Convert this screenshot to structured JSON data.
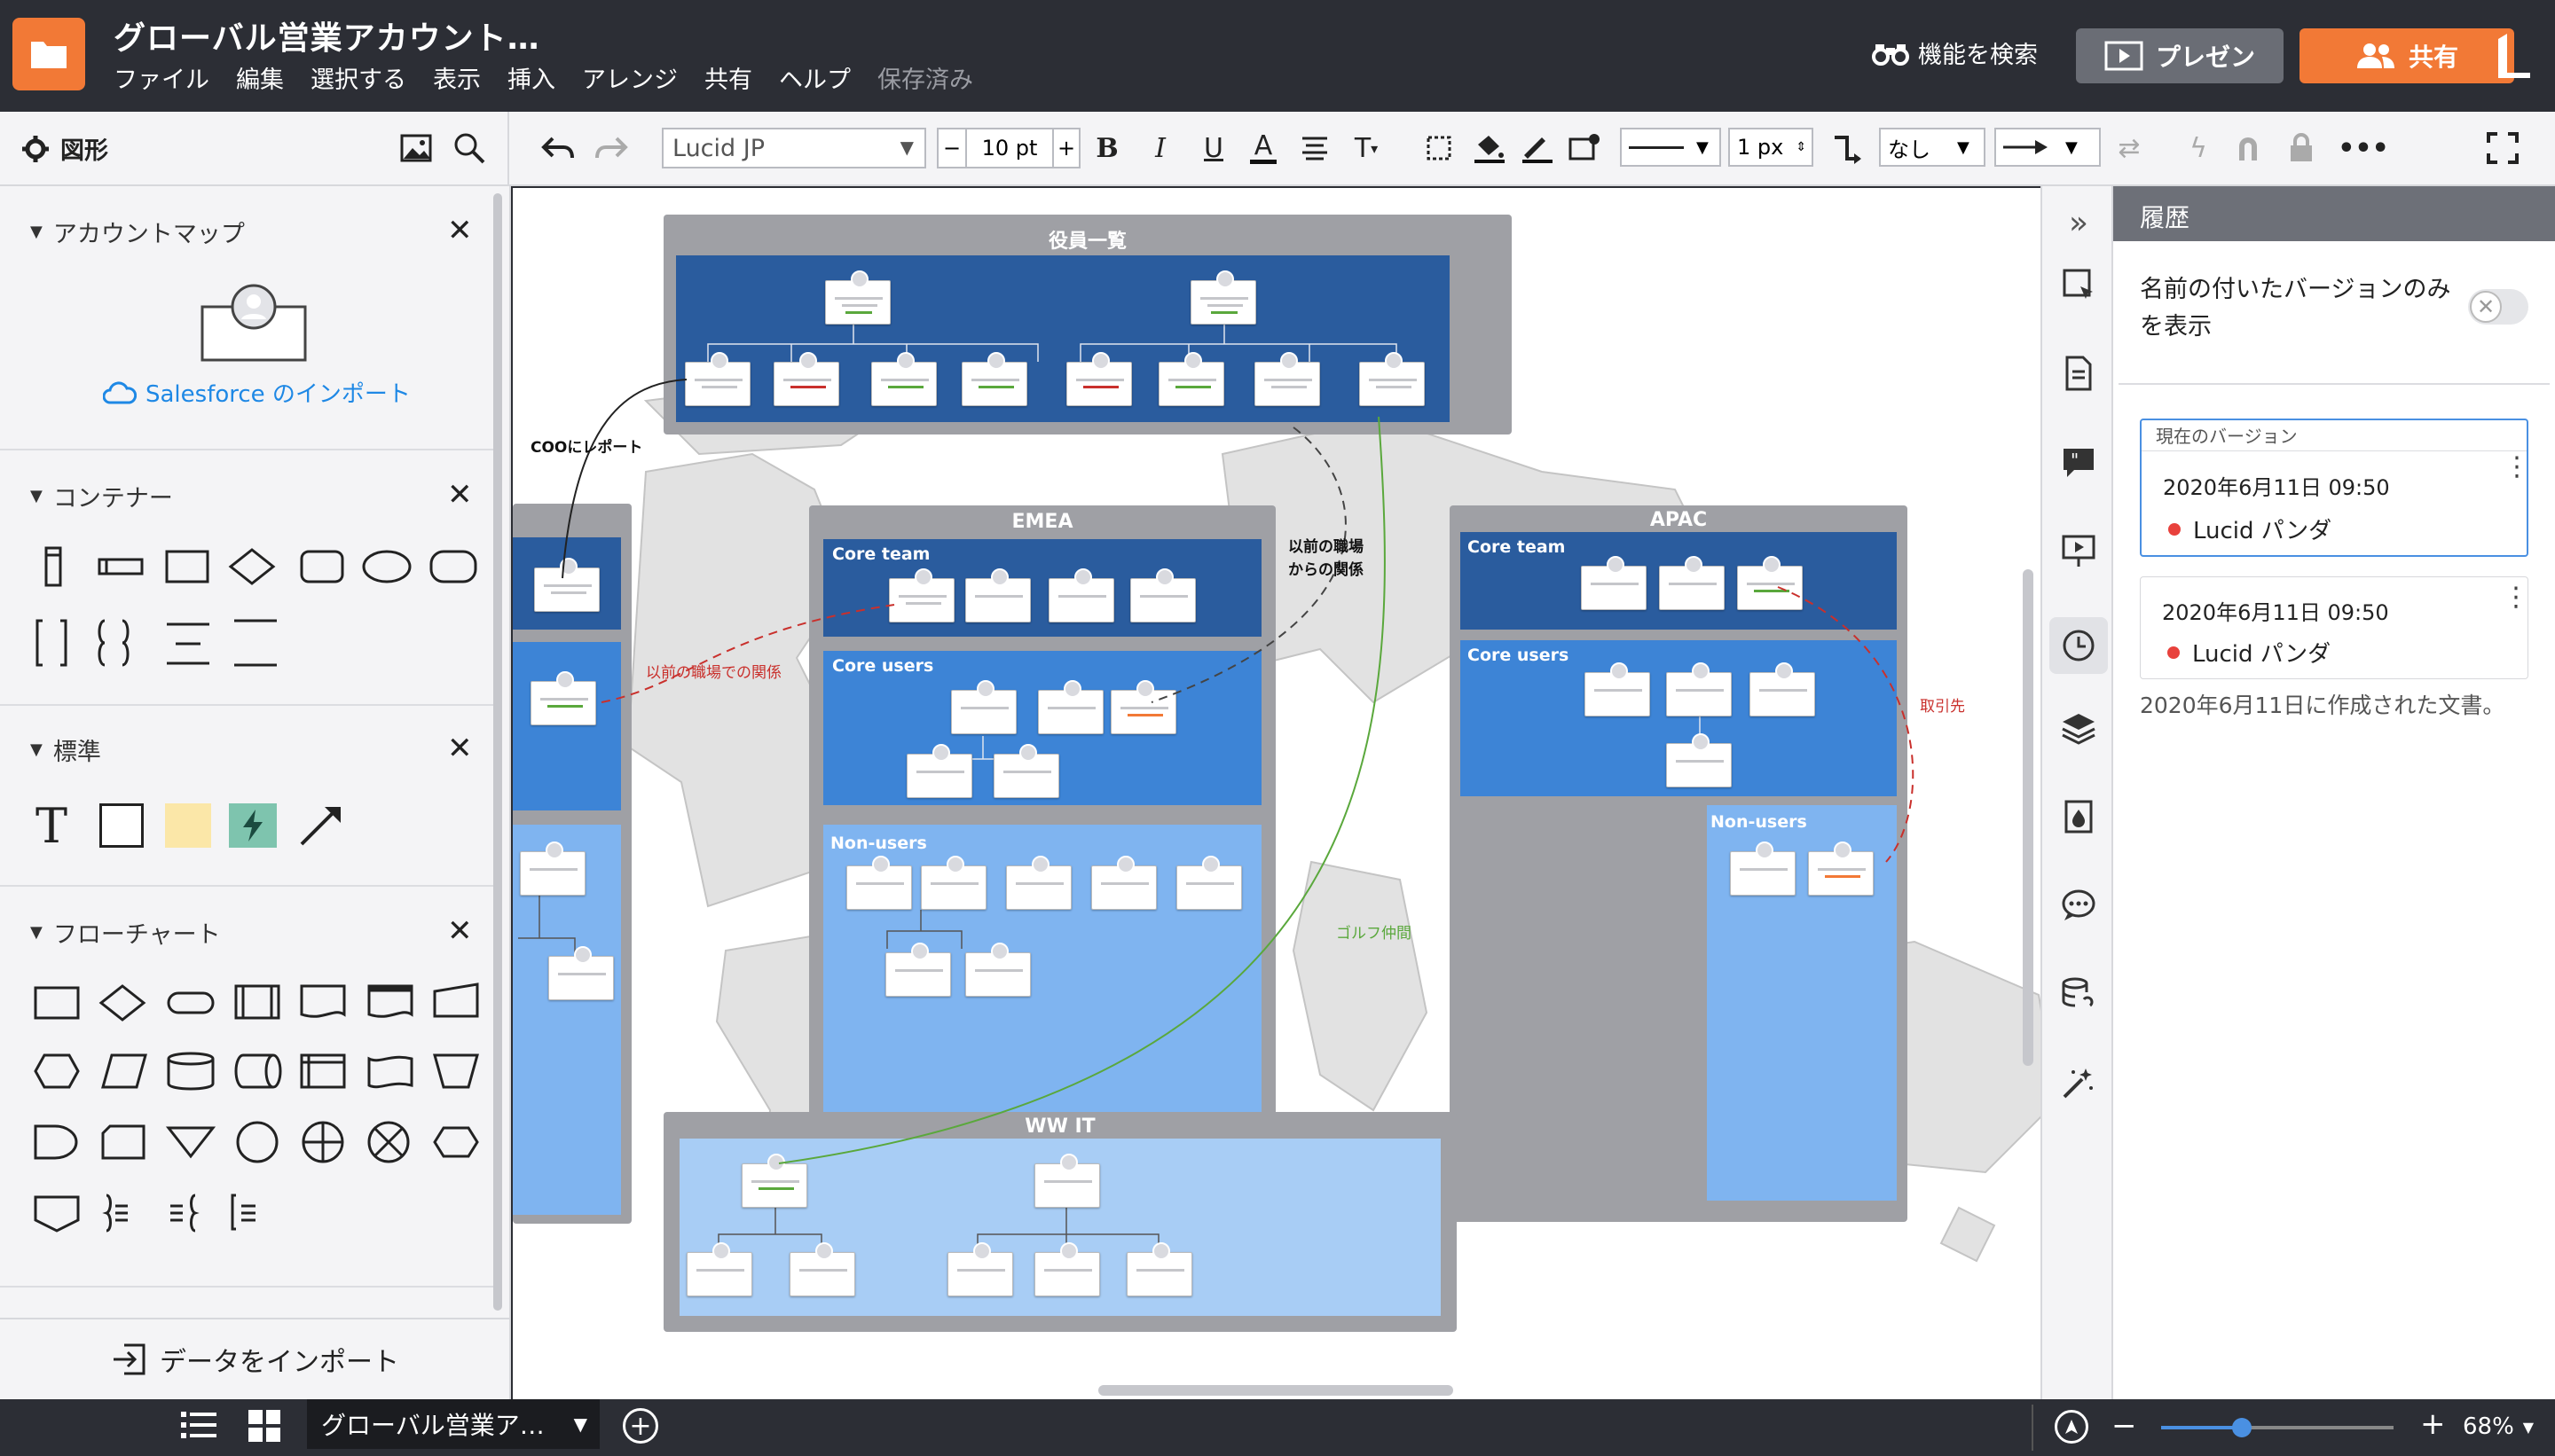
{
  "app": {
    "document_title": "グローバル営業アカウント…",
    "menu": [
      "ファイル",
      "編集",
      "選択する",
      "表示",
      "挿入",
      "アレンジ",
      "共有",
      "ヘルプ"
    ],
    "saved_status": "保存済み",
    "find_feature": "機能を検索",
    "present_label": "プレゼン",
    "share_label": "共有"
  },
  "toolbar": {
    "shapes_label": "図形",
    "font": "Lucid JP",
    "font_size": "10 pt",
    "line_width": "1 px",
    "arrow_none": "なし"
  },
  "left_panel": {
    "sections": [
      {
        "title": "アカウントマップ",
        "action": "Salesforce のインポート"
      },
      {
        "title": "コンテナー"
      },
      {
        "title": "標準"
      },
      {
        "title": "フローチャート"
      }
    ],
    "import_data": "データをインポート"
  },
  "canvas": {
    "containers": {
      "exec": "役員一覧",
      "emea": "EMEA",
      "apac": "APAC",
      "wwit": "WW IT"
    },
    "groups": {
      "core_team": "Core team",
      "core_users": "Core users",
      "non_users": "Non-users"
    },
    "labels": {
      "coo_report": "COOにレポート",
      "prev_job_relation": "以前の職場での関係",
      "prev_job_relation2_l1": "以前の職場",
      "prev_job_relation2_l2": "からの関係",
      "client": "取引先",
      "golf": "ゴルフ仲間"
    }
  },
  "history": {
    "title": "履歴",
    "toggle_label_l1": "名前の付いたバージョンのみ",
    "toggle_label_l2": "を表示",
    "current_version_label": "現在のバージョン",
    "versions": [
      {
        "date": "2020年6月11日 09:50",
        "author": "Lucid パンダ"
      },
      {
        "date": "2020年6月11日 09:50",
        "author": "Lucid パンダ"
      }
    ],
    "created_note": "2020年6月11日に作成された文書。",
    "author_dot_color": "#e8413c"
  },
  "bottom": {
    "page_tab": "グローバル営業ア…",
    "zoom": "68%"
  },
  "colors": {
    "brand_orange": "#f27936",
    "dark_blue": "#2a5c9e",
    "mid_blue": "#3d84d6",
    "light_blue": "#7fb4f0",
    "container_gray": "#9fa0a5"
  }
}
